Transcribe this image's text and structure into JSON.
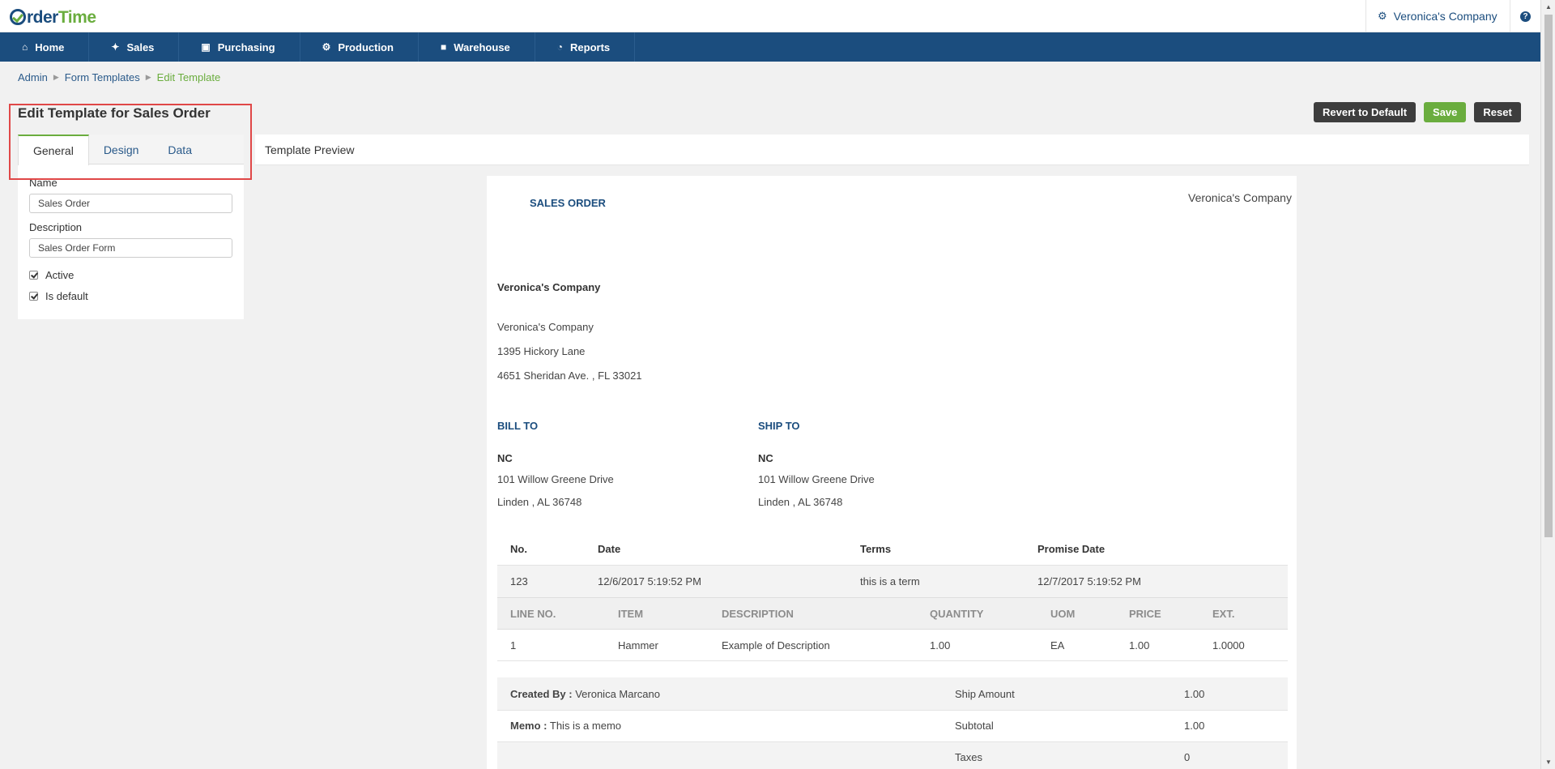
{
  "topbar": {
    "logo_order": "rder",
    "logo_time": "Time",
    "company": "Veronica's Company",
    "help": "?"
  },
  "nav": {
    "items": [
      {
        "label": "Home",
        "icon": "home-icon"
      },
      {
        "label": "Sales",
        "icon": "tag-icon"
      },
      {
        "label": "Purchasing",
        "icon": "cart-icon"
      },
      {
        "label": "Production",
        "icon": "gears-icon"
      },
      {
        "label": "Warehouse",
        "icon": "box-icon"
      },
      {
        "label": "Reports",
        "icon": "pie-chart-icon"
      }
    ]
  },
  "breadcrumb": [
    "Admin",
    "Form Templates",
    "Edit Template"
  ],
  "page_title": "Edit Template for Sales Order",
  "actions": {
    "revert": "Revert to Default",
    "save": "Save",
    "reset": "Reset"
  },
  "tabs": [
    "General",
    "Design",
    "Data"
  ],
  "form": {
    "name_label": "Name",
    "name_value": "Sales Order",
    "description_label": "Description",
    "description_value": "Sales Order Form",
    "active_label": "Active",
    "active_checked": true,
    "default_label": "Is default",
    "default_checked": true
  },
  "preview": {
    "header": "Template Preview",
    "doc_title": "SALES ORDER",
    "company_top": "Veronica's Company",
    "company_bold": "Veronica's Company",
    "address_lines": [
      "Veronica's Company",
      "1395 Hickory Lane",
      "4651 Sheridan Ave. , FL 33021"
    ],
    "bill_to": {
      "heading": "BILL TO",
      "name": "NC",
      "line1": "101 Willow Greene Drive",
      "line2": "Linden , AL 36748"
    },
    "ship_to": {
      "heading": "SHIP TO",
      "name": "NC",
      "line1": "101 Willow Greene Drive",
      "line2": "Linden , AL 36748"
    },
    "info_headers": [
      "No.",
      "Date",
      "Terms",
      "Promise Date"
    ],
    "info_values": [
      "123",
      "12/6/2017 5:19:52 PM",
      "this is a term",
      "12/7/2017 5:19:52 PM"
    ],
    "line_headers": [
      "LINE NO.",
      "ITEM",
      "DESCRIPTION",
      "QUANTITY",
      "UOM",
      "PRICE",
      "EXT."
    ],
    "line_values": [
      "1",
      "Hammer",
      "Example of Description",
      "1.00",
      "EA",
      "1.00",
      "1.0000"
    ],
    "created_by_label": "Created By :",
    "created_by_value": "Veronica Marcano",
    "memo_label": "Memo :",
    "memo_value": "This is a memo",
    "totals": [
      {
        "label": "Ship Amount",
        "value": "1.00"
      },
      {
        "label": "Subtotal",
        "value": "1.00"
      },
      {
        "label": "Taxes",
        "value": "0"
      }
    ]
  }
}
